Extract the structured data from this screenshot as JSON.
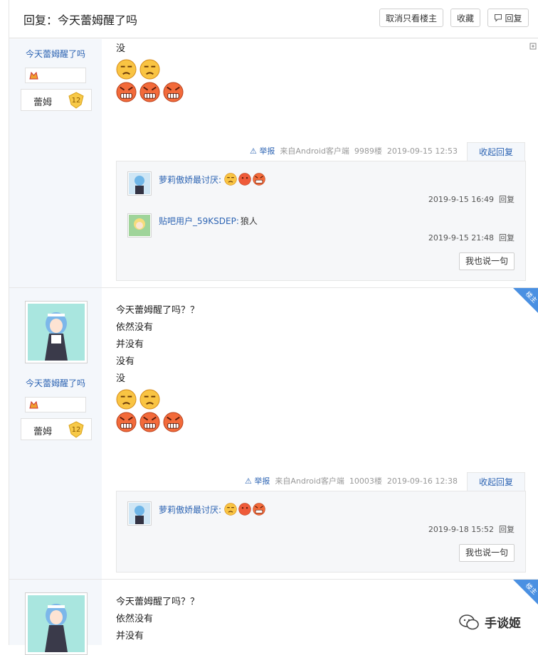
{
  "header": {
    "title": "回复：今天蕾姆醒了吗",
    "buttons": {
      "only_op": "取消只看楼主",
      "favorite": "收藏",
      "reply": "回复"
    }
  },
  "posts": [
    {
      "author": "今天蕾姆醒了吗",
      "user_title": "蕾姆",
      "level": "12",
      "lines": [
        "没"
      ],
      "meta": {
        "report": "举报",
        "source": "来自Android客户端",
        "floor": "9989楼",
        "time": "2019-09-15 12:53"
      },
      "collapse": "收起回复",
      "replies": [
        {
          "user": "萝莉傲娇最讨厌:",
          "text": "",
          "time": "2019-9-15 16:49",
          "reply": "回复"
        },
        {
          "user": "贴吧用户_59KSDEP:",
          "text": "狼人",
          "time": "2019-9-15 21:48",
          "reply": "回复"
        }
      ],
      "say_more": "我也说一句"
    },
    {
      "author": "今天蕾姆醒了吗",
      "user_title": "蕾姆",
      "level": "12",
      "badge": "楼主",
      "lines": [
        "今天蕾姆醒了吗？？",
        "依然没有",
        "并没有",
        "没有",
        "没"
      ],
      "meta": {
        "report": "举报",
        "source": "来自Android客户端",
        "floor": "10003楼",
        "time": "2019-09-16 12:38"
      },
      "collapse": "收起回复",
      "replies": [
        {
          "user": "萝莉傲娇最讨厌:",
          "text": "",
          "time": "2019-9-18 15:52",
          "reply": "回复"
        }
      ],
      "say_more": "我也说一句"
    },
    {
      "badge": "楼主",
      "lines": [
        "今天蕾姆醒了吗？？",
        "依然没有",
        "并没有"
      ]
    }
  ],
  "watermark": "手谈姬",
  "colors": {
    "link": "#2d64b3",
    "sidebar": "#f4f7fb",
    "badge": "#4a90e2"
  }
}
